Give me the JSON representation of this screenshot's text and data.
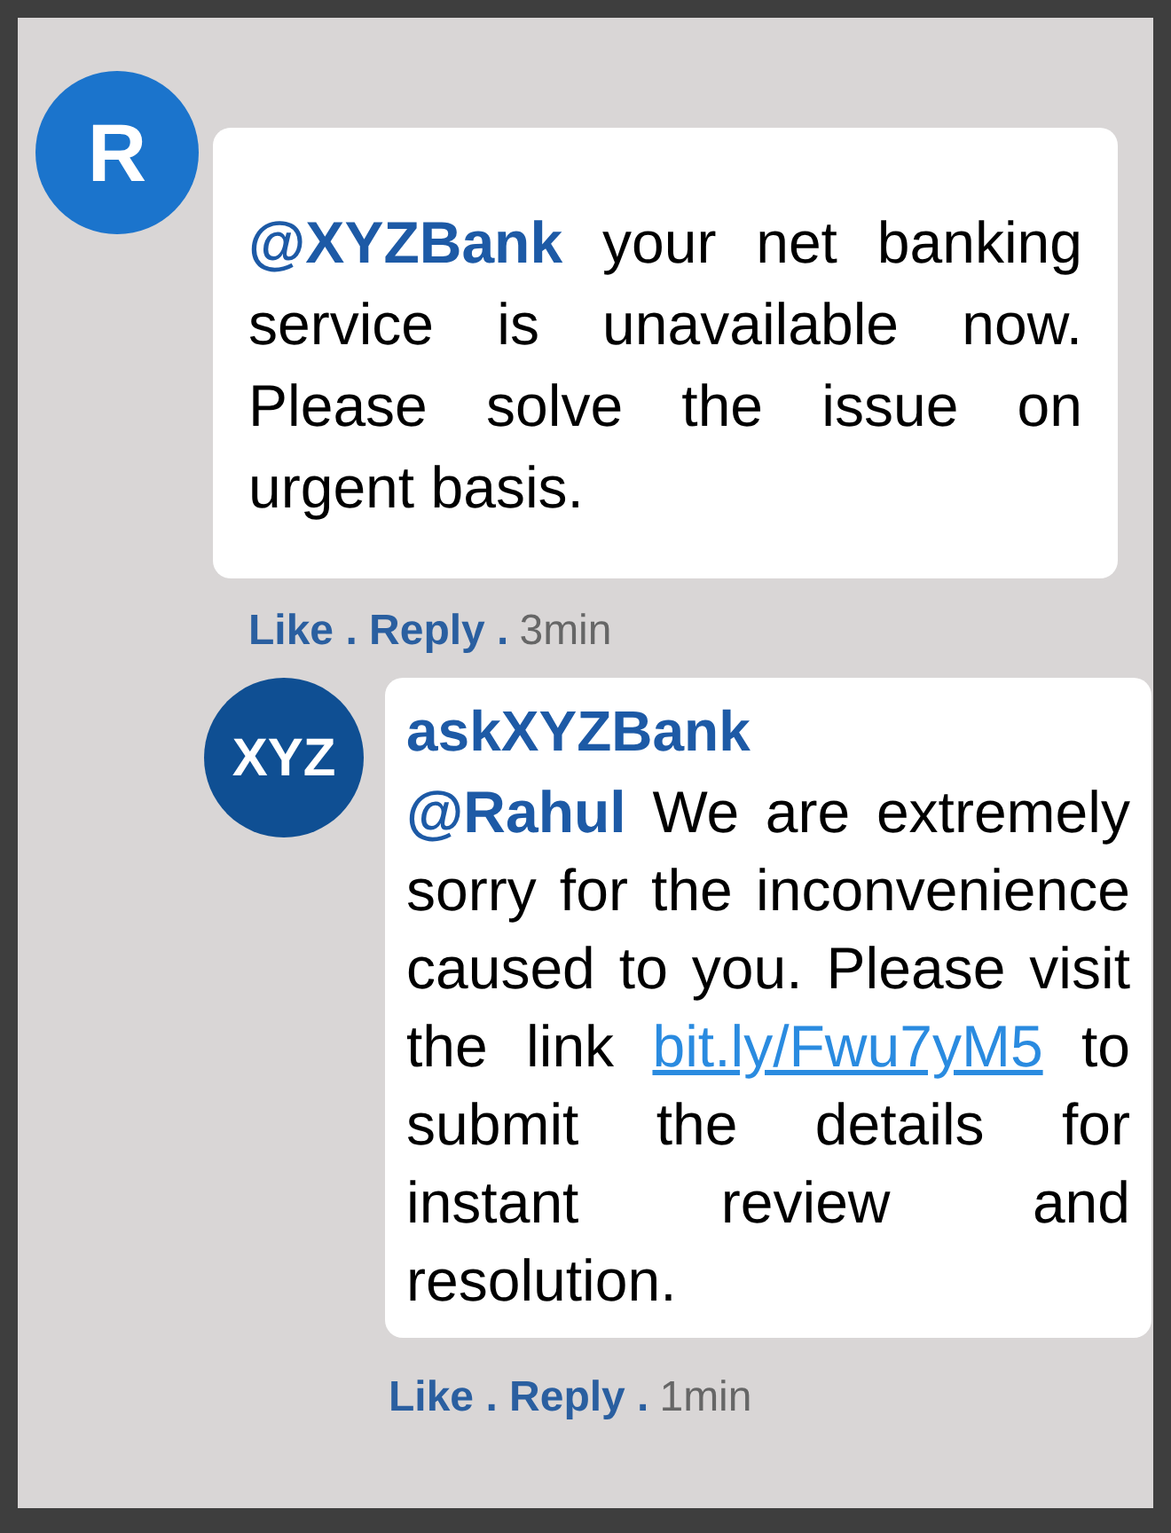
{
  "comments": [
    {
      "avatar": "R",
      "color": "#1b74cc",
      "body_before": "**@XYZBank** your net banking service is unavailable now. Please solve the issue on urgent basis.",
      "actions": "Like . Reply .",
      "time": "3min"
    },
    {
      "avatar": "XYZ",
      "color": "#0f4f93",
      "author": "askXYZBank",
      "body_before": "**@Rahul** We are extremely sorry for the inconvenience caused to you. Please visit the link",
      "link": "bit.ly/Fwu7yM5",
      "body_after": "to submit the details for instant review and resolution.",
      "actions": "Like . Reply .",
      "time": "1min"
    }
  ]
}
